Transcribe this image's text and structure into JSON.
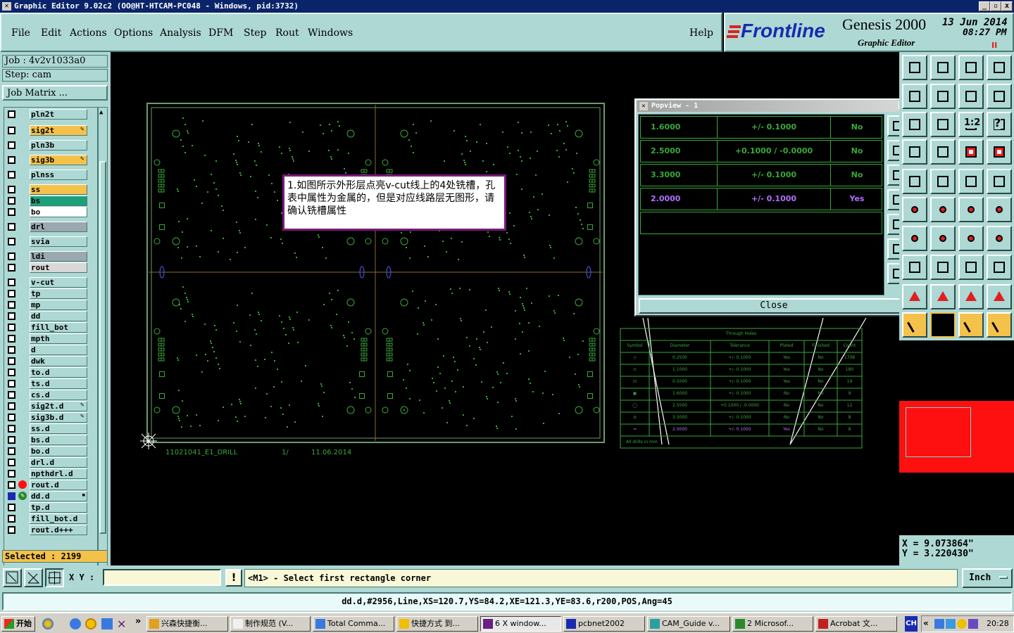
{
  "window": {
    "title": "Graphic Editor 9.02c2  (OO@HT-HTCAM-PC048 - Windows, pid:3732)",
    "min_label": "_",
    "max_label": "▫",
    "close_label": "x"
  },
  "menu": {
    "items": [
      {
        "label": "File"
      },
      {
        "label": "Edit"
      },
      {
        "label": "Actions"
      },
      {
        "label": "Options"
      },
      {
        "label": "Analysis"
      },
      {
        "label": "DFM"
      },
      {
        "label": "Step"
      },
      {
        "label": "Rout"
      },
      {
        "label": "Windows"
      }
    ],
    "help": "Help"
  },
  "brand": {
    "logo": "Frontline",
    "product": "Genesis 2000",
    "subtitle": "Graphic Editor",
    "date": "13  Jun  2014",
    "time": "08:27  PM",
    "pause_label": "II"
  },
  "job": {
    "job_label": "Job  :  4v2v1033a0",
    "step_label": "Step:  cam",
    "matrix_button": "Job Matrix ..."
  },
  "layers": [
    {
      "name": "pln2t",
      "color": "#aed8d4",
      "gap": false
    },
    {
      "name": "sig2t",
      "color": "#f4c24a",
      "edit": true
    },
    {
      "name": "pln3b",
      "color": "#aed8d4"
    },
    {
      "name": "sig3b",
      "color": "#f4c24a",
      "edit": true
    },
    {
      "name": "plnss",
      "color": "#aed8d4"
    },
    {
      "name": "ss",
      "color": "#f4c24a"
    },
    {
      "name": "bs",
      "color": "#1ca07a"
    },
    {
      "name": "bo",
      "color": "#ffffff"
    },
    {
      "name": "drl",
      "color": "#9aa8b0"
    },
    {
      "name": "svia",
      "color": "#aed8d4"
    },
    {
      "name": "ldi",
      "color": "#9aa8b0"
    },
    {
      "name": "rout",
      "color": "#d8d8d8"
    },
    {
      "name": "v-cut",
      "color": "#aed8d4"
    },
    {
      "name": "tp",
      "color": "#aed8d4"
    },
    {
      "name": "mp",
      "color": "#aed8d4"
    },
    {
      "name": "dd",
      "color": "#aed8d4"
    },
    {
      "name": "fill_bot",
      "color": "#aed8d4"
    },
    {
      "name": "mpth",
      "color": "#aed8d4"
    },
    {
      "name": "d",
      "color": "#aed8d4"
    },
    {
      "name": "dwk",
      "color": "#aed8d4"
    },
    {
      "name": "to.d",
      "color": "#aed8d4"
    },
    {
      "name": "ts.d",
      "color": "#aed8d4"
    },
    {
      "name": "cs.d",
      "color": "#aed8d4"
    },
    {
      "name": "sig2t.d",
      "color": "#aed8d4",
      "edit": true
    },
    {
      "name": "sig3b.d",
      "color": "#aed8d4",
      "edit": true
    },
    {
      "name": "ss.d",
      "color": "#aed8d4"
    },
    {
      "name": "bs.d",
      "color": "#aed8d4"
    },
    {
      "name": "bo.d",
      "color": "#aed8d4"
    },
    {
      "name": "drl.d",
      "color": "#aed8d4"
    },
    {
      "name": "npthdrl.d",
      "color": "#aed8d4"
    },
    {
      "name": "rout.d",
      "color": "#aed8d4",
      "mark": "red-dot"
    },
    {
      "name": "dd.d",
      "color": "#aed8d4",
      "mark": "work-icon",
      "active": true
    },
    {
      "name": "tp.d",
      "color": "#aed8d4"
    },
    {
      "name": "fill_bot.d",
      "color": "#aed8d4"
    },
    {
      "name": "rout.d+++",
      "color": "#aed8d4"
    }
  ],
  "selected": "Selected  :  2199",
  "canvas": {
    "board_label": "11021041_E1_DRILL",
    "board_page": "1/",
    "board_date": "11.06.2014",
    "annotation": "1.如图所示外形层点亮v-cut线上的4处铣槽，孔表中属性为金属的，但是对应线路层无图形，请确认铣槽属性",
    "table_title": "Through Holes",
    "table_headers": [
      "Symbol",
      "Diameter",
      "Tolerance",
      "Plated",
      "Finished",
      "Count"
    ],
    "table_rows": [
      [
        "◇",
        "0.2500",
        "+/- 0.1000",
        "Yes",
        "No",
        "1708"
      ],
      [
        "⊙",
        "1.1000",
        "+/- 0.1000",
        "Yes",
        "No",
        "180"
      ],
      [
        "⊡",
        "0.5000",
        "+/- 0.1000",
        "Yes",
        "No",
        "19"
      ],
      [
        "▣",
        "1.6000",
        "+/- 0.1000",
        "No",
        "No",
        "9"
      ],
      [
        "◯",
        "2.5000",
        "+0.1000 / -0.0000",
        "No",
        "No",
        "12"
      ],
      [
        "⊘",
        "3.3000",
        "+/- 0.1000",
        "No",
        "No",
        "8"
      ],
      [
        "≈",
        "2.0000",
        "+/- 0.1000",
        "Yes",
        "No",
        "8"
      ]
    ],
    "table_footer": "All drills in mm"
  },
  "popview": {
    "title": "Popview - 1",
    "close_label": "Close",
    "rows": [
      {
        "diameter": "1.6000",
        "tolerance": "+/- 0.1000",
        "plated": "No",
        "highlight": false
      },
      {
        "diameter": "2.5000",
        "tolerance": "+0.1000 / -0.0000",
        "plated": "No",
        "highlight": false
      },
      {
        "diameter": "3.3000",
        "tolerance": "+/- 0.1000",
        "plated": "No",
        "highlight": false
      },
      {
        "diameter": "2.0000",
        "tolerance": "+/- 0.1000",
        "plated": "Yes",
        "highlight": true
      }
    ]
  },
  "tools": {
    "icons": [
      "layer-up-icon",
      "layer-down-icon",
      "home-icon",
      "window-icon",
      "zoom-fit-icon",
      "zoom-in-icon",
      "swap-icon",
      "snap-icon",
      "pan-icon",
      "move-center-icon",
      "scale-icon",
      "help-query-icon",
      "settings-icon",
      "grid-icon",
      "panel-red-icon",
      "panel-red2-icon",
      "select-icon",
      "shape-icon",
      "ruler-icon",
      "dot-icon",
      "node-icon",
      "cross-icon",
      "node-link-icon",
      "node-link2-icon",
      "draw-line-icon",
      "draw-line2-icon",
      "arc-icon",
      "flip-icon",
      "mark-icon",
      "line-icon",
      "measure-icon",
      "blob-icon",
      "triangle-icon",
      "triangle2-icon",
      "triangle3-icon",
      "triangle4-icon",
      "arrow-icon",
      "arrow-selected-icon",
      "arrow2-icon",
      "path-icon"
    ],
    "one_to_one": "1:2",
    "question": "?"
  },
  "coordinates": {
    "x": "X  =  9.073864\"",
    "y": "Y  =  3.220430\""
  },
  "bottom": {
    "xy_label": "X Y :",
    "xy_value": "",
    "exclaim": "!",
    "prompt": "<M1> - Select first rectangle corner",
    "units": "Inch"
  },
  "status": {
    "text": "dd.d,#2956,Line,XS=120.7,YS=84.2,XE=121.3,YE=83.6,r200,POS,Ang=45"
  },
  "taskbar": {
    "start": "开始",
    "chevron": "»",
    "tasks": [
      {
        "label": "兴森快捷衡..."
      },
      {
        "label": "制作规范 (V..."
      },
      {
        "label": "Total Comma..."
      },
      {
        "label": "快捷方式 到..."
      },
      {
        "label": "6 X window..."
      },
      {
        "label": "pcbnet2002"
      },
      {
        "label": "CAM_Guide v..."
      },
      {
        "label": "2 Microsof..."
      },
      {
        "label": "Acrobat 文..."
      }
    ],
    "lang": "CH",
    "tray_chevron": "«",
    "clock": "20:28"
  },
  "colors": {
    "panel": "#aed8d4",
    "board_outline": "#6e9a6e",
    "pads": "#3aa83a",
    "vcut": "#8a6a2a",
    "slot": "#4a5aff",
    "highlight": "#b070ff",
    "table_green": "#3aa83a"
  }
}
